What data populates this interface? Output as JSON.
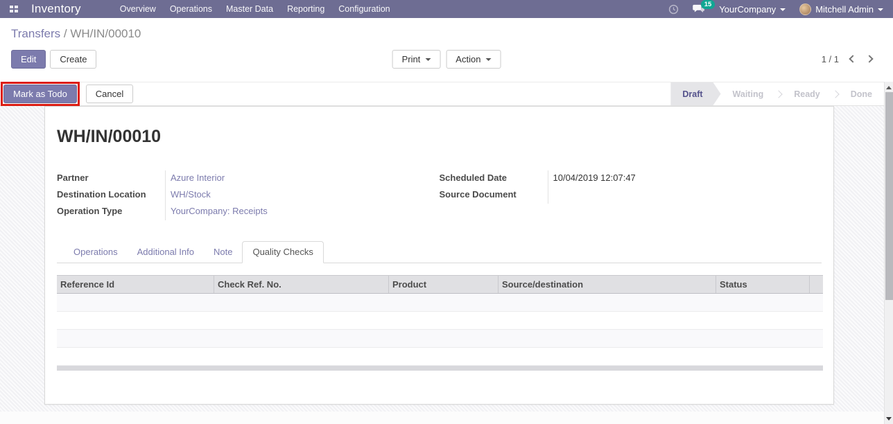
{
  "nav": {
    "app_title": "Inventory",
    "menus": [
      "Overview",
      "Operations",
      "Master Data",
      "Reporting",
      "Configuration"
    ],
    "messages_badge": "15",
    "company_menu": "YourCompany",
    "user_menu": "Mitchell Admin"
  },
  "breadcrumb": {
    "parent": "Transfers",
    "separator": " / ",
    "current": "WH/IN/00010"
  },
  "control_panel": {
    "edit": "Edit",
    "create": "Create",
    "print": "Print",
    "action": "Action",
    "pager": "1 / 1"
  },
  "status_row": {
    "mark_as_todo": "Mark as Todo",
    "cancel": "Cancel",
    "steps": [
      "Draft",
      "Waiting",
      "Ready",
      "Done"
    ],
    "active_step": "Draft"
  },
  "form": {
    "title": "WH/IN/00010",
    "fields_left": [
      {
        "label": "Partner",
        "value": "Azure Interior"
      },
      {
        "label": "Destination Location",
        "value": "WH/Stock"
      },
      {
        "label": "Operation Type",
        "value": "YourCompany: Receipts"
      }
    ],
    "fields_right": [
      {
        "label": "Scheduled Date",
        "value": "10/04/2019 12:07:47"
      },
      {
        "label": "Source Document",
        "value": ""
      }
    ],
    "tabs": [
      "Operations",
      "Additional Info",
      "Note",
      "Quality Checks"
    ],
    "active_tab": "Quality Checks",
    "table": {
      "columns": [
        "Reference Id",
        "Check Ref. No.",
        "Product",
        "Source/destination",
        "Status"
      ],
      "rows": []
    }
  },
  "colors": {
    "navbar": "#6e6d93",
    "primary_button": "#7c7bad",
    "badge": "#10a793",
    "link": "#7c7bad",
    "annotation_highlight": "#dc1d13"
  }
}
